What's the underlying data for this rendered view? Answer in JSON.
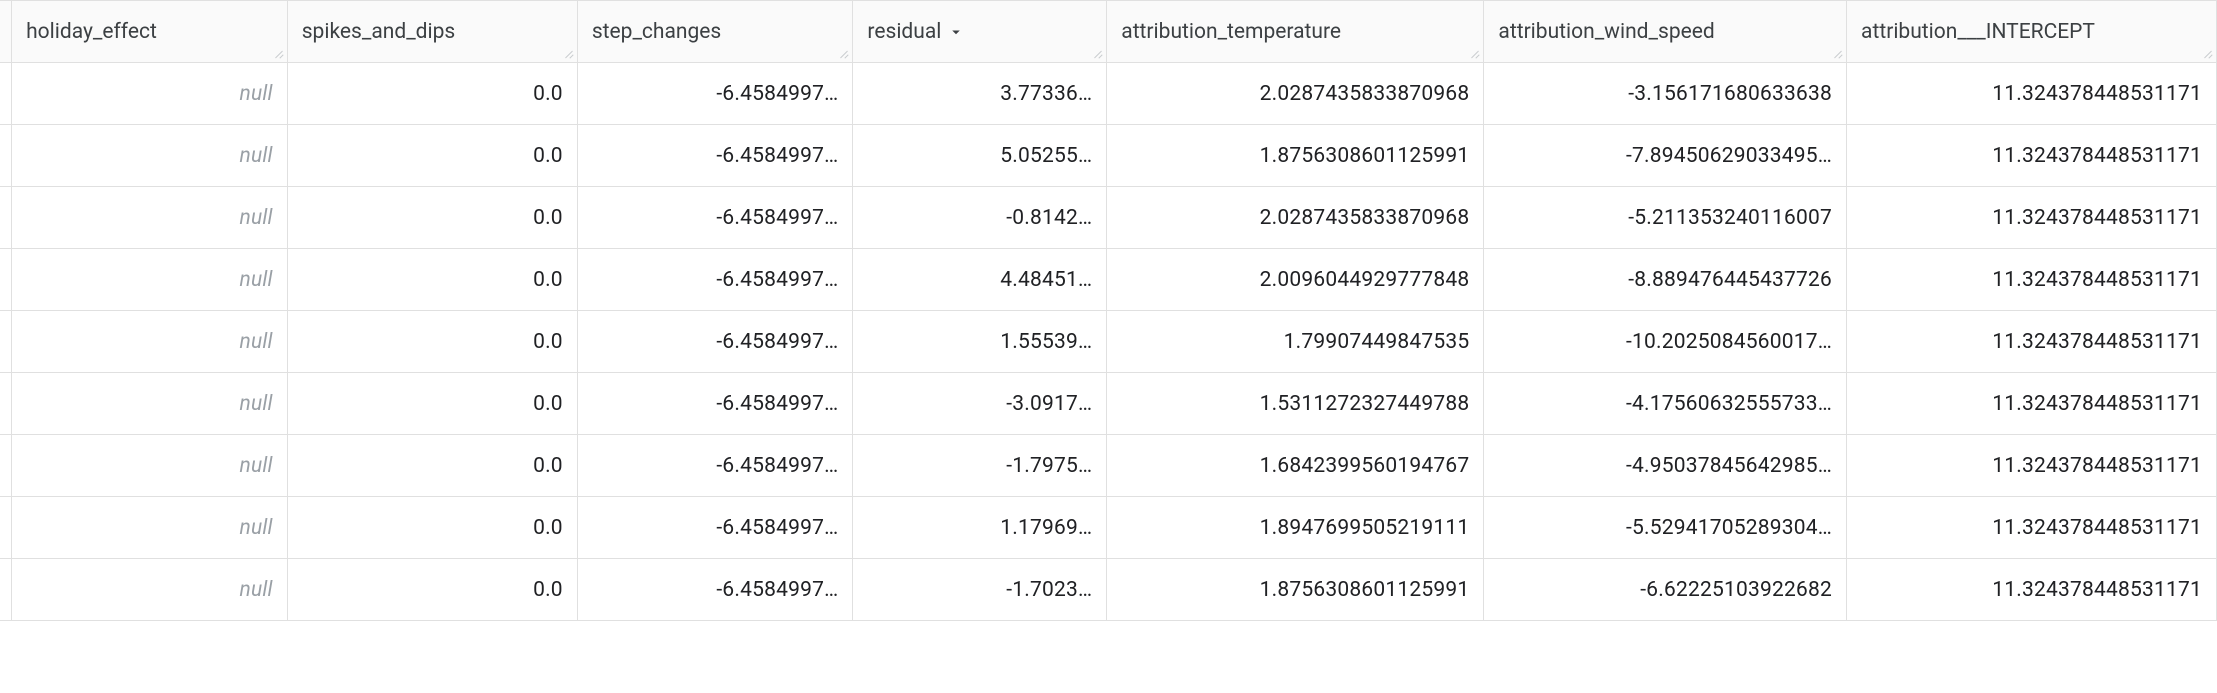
{
  "columns": [
    {
      "key": "holiday_effect",
      "label": "holiday_effect",
      "sort": null
    },
    {
      "key": "spikes_and_dips",
      "label": "spikes_and_dips",
      "sort": null
    },
    {
      "key": "step_changes",
      "label": "step_changes",
      "sort": null
    },
    {
      "key": "residual",
      "label": "residual",
      "sort": "desc"
    },
    {
      "key": "attribution_temperature",
      "label": "attribution_temperature",
      "sort": null
    },
    {
      "key": "attribution_wind_speed",
      "label": "attribution_wind_speed",
      "sort": null
    },
    {
      "key": "attribution___INTERCEPT",
      "label": "attribution___INTERCEPT",
      "sort": null
    }
  ],
  "null_text": "null",
  "rows": [
    {
      "holiday_effect": null,
      "spikes_and_dips": "0.0",
      "step_changes": "-6.4584997…",
      "residual": "3.77336…",
      "attribution_temperature": "2.0287435833870968",
      "attribution_wind_speed": "-3.156171680633638",
      "attribution___INTERCEPT": "11.324378448531171"
    },
    {
      "holiday_effect": null,
      "spikes_and_dips": "0.0",
      "step_changes": "-6.4584997…",
      "residual": "5.05255…",
      "attribution_temperature": "1.8756308601125991",
      "attribution_wind_speed": "-7.89450629033495…",
      "attribution___INTERCEPT": "11.324378448531171"
    },
    {
      "holiday_effect": null,
      "spikes_and_dips": "0.0",
      "step_changes": "-6.4584997…",
      "residual": "-0.8142…",
      "attribution_temperature": "2.0287435833870968",
      "attribution_wind_speed": "-5.211353240116007",
      "attribution___INTERCEPT": "11.324378448531171"
    },
    {
      "holiday_effect": null,
      "spikes_and_dips": "0.0",
      "step_changes": "-6.4584997…",
      "residual": "4.48451…",
      "attribution_temperature": "2.0096044929777848",
      "attribution_wind_speed": "-8.889476445437726",
      "attribution___INTERCEPT": "11.324378448531171"
    },
    {
      "holiday_effect": null,
      "spikes_and_dips": "0.0",
      "step_changes": "-6.4584997…",
      "residual": "1.55539…",
      "attribution_temperature": "1.79907449847535",
      "attribution_wind_speed": "-10.2025084560017…",
      "attribution___INTERCEPT": "11.324378448531171"
    },
    {
      "holiday_effect": null,
      "spikes_and_dips": "0.0",
      "step_changes": "-6.4584997…",
      "residual": "-3.0917…",
      "attribution_temperature": "1.5311272327449788",
      "attribution_wind_speed": "-4.17560632555733…",
      "attribution___INTERCEPT": "11.324378448531171"
    },
    {
      "holiday_effect": null,
      "spikes_and_dips": "0.0",
      "step_changes": "-6.4584997…",
      "residual": "-1.7975…",
      "attribution_temperature": "1.6842399560194767",
      "attribution_wind_speed": "-4.95037845642985…",
      "attribution___INTERCEPT": "11.324378448531171"
    },
    {
      "holiday_effect": null,
      "spikes_and_dips": "0.0",
      "step_changes": "-6.4584997…",
      "residual": "1.17969…",
      "attribution_temperature": "1.8947699505219111",
      "attribution_wind_speed": "-5.52941705289304…",
      "attribution___INTERCEPT": "11.324378448531171"
    },
    {
      "holiday_effect": null,
      "spikes_and_dips": "0.0",
      "step_changes": "-6.4584997…",
      "residual": "-1.7023…",
      "attribution_temperature": "1.8756308601125991",
      "attribution_wind_speed": "-6.62225103922682",
      "attribution___INTERCEPT": "11.324378448531171"
    }
  ]
}
